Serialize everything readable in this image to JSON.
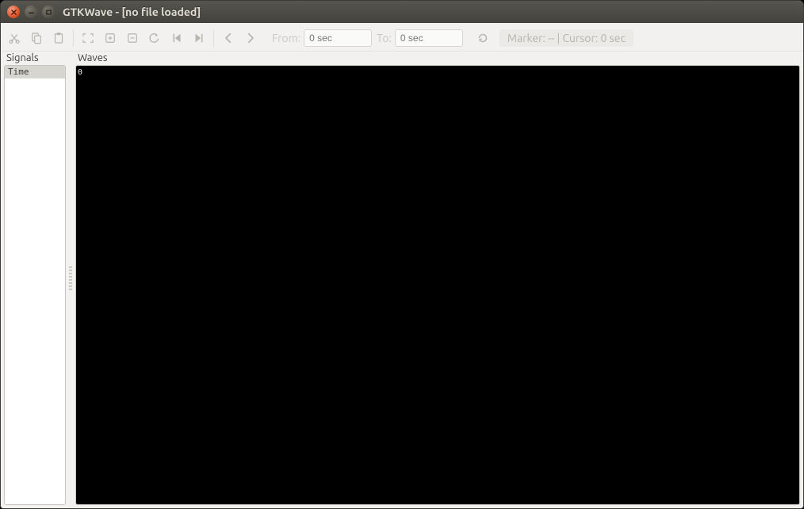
{
  "window": {
    "title": "GTKWave - [no file loaded]"
  },
  "toolbar": {
    "from_label": "From:",
    "from_value": "0 sec",
    "to_label": "To:",
    "to_value": "0 sec"
  },
  "status": {
    "marker_label": "Marker:",
    "marker_value": "--",
    "cursor_label": "Cursor:",
    "cursor_value": "0 sec"
  },
  "panes": {
    "signals_header": "Signals",
    "waves_header": "Waves",
    "signal_row_label": "Time",
    "wave_origin": "0"
  }
}
